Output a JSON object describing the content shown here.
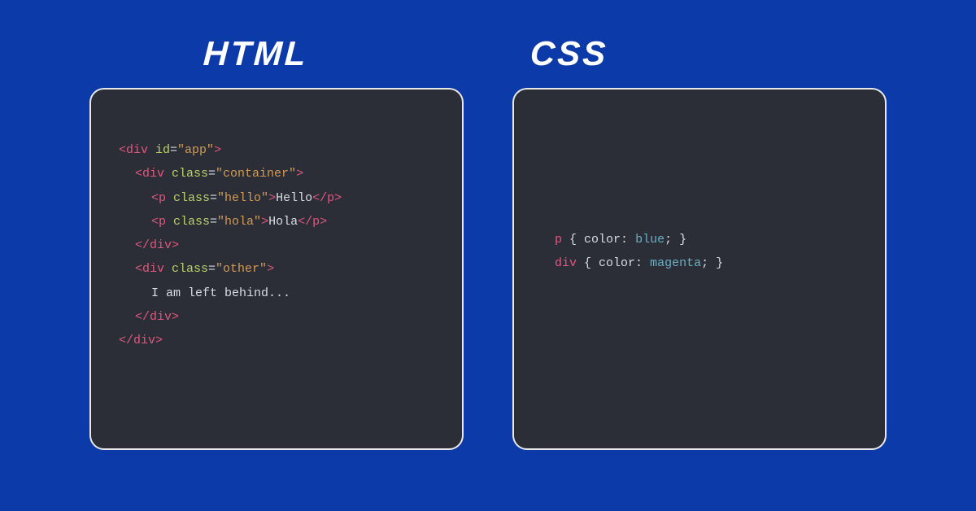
{
  "headings": {
    "html": "HTML",
    "css": "CSS"
  },
  "html_code": {
    "l1": {
      "open": "<div",
      "attr": " id",
      "eq": "=",
      "val": "\"app\"",
      "close": ">"
    },
    "l2": {
      "open": "<div",
      "attr": " class",
      "eq": "=",
      "val": "\"container\"",
      "close": ">"
    },
    "l3": {
      "open": "<p",
      "attr": " class",
      "eq": "=",
      "val": "\"hello\"",
      "close": ">",
      "text": "Hello",
      "closetag": "</p>"
    },
    "l4": {
      "open": "<p",
      "attr": " class",
      "eq": "=",
      "val": "\"hola\"",
      "close": ">",
      "text": "Hola",
      "closetag": "</p>"
    },
    "l5": {
      "closetag": "</div>"
    },
    "l6": {
      "open": "<div",
      "attr": " class",
      "eq": "=",
      "val": "\"other\"",
      "close": ">"
    },
    "l7": {
      "text": "I am left behind..."
    },
    "l8": {
      "closetag": "</div>"
    },
    "l9": {
      "closetag": "</div>"
    }
  },
  "css_code": {
    "r1": {
      "sel": "p",
      "open": " { ",
      "prop": "color",
      "colon": ": ",
      "val": "blue",
      "semi": ";",
      "close": " }"
    },
    "r2": {
      "sel": "div",
      "open": " { ",
      "prop": "color",
      "colon": ": ",
      "val": "magenta",
      "semi": ";",
      "close": " }"
    }
  }
}
